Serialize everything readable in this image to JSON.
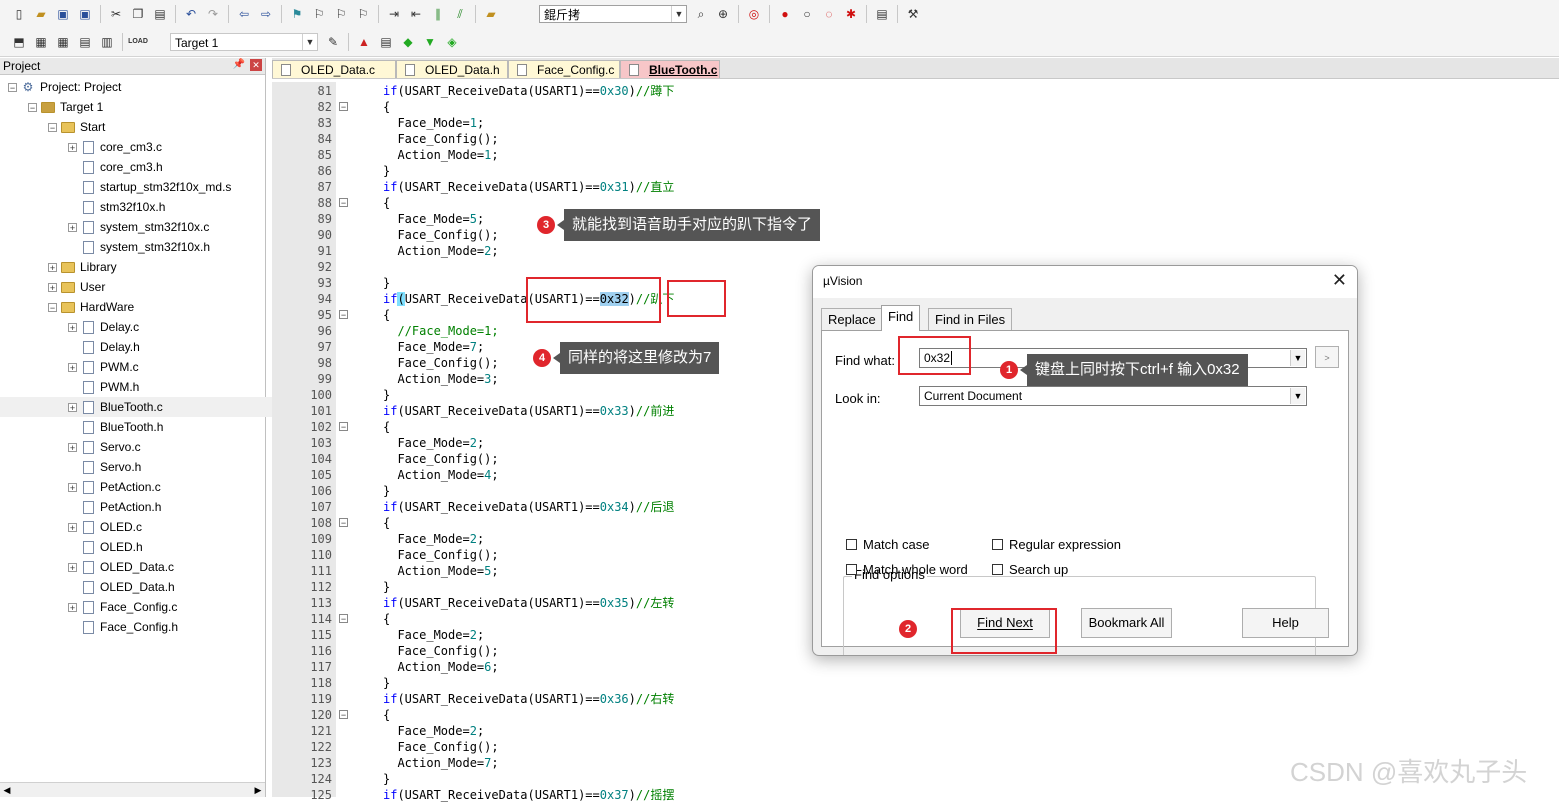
{
  "toolbar1": {
    "icons": [
      "new-file-icon",
      "open-folder-icon",
      "save-icon",
      "save-all-icon",
      "cut-icon",
      "copy-icon",
      "paste-icon",
      "undo-icon",
      "redo-icon",
      "nav-back-icon",
      "nav-forward-icon",
      "bookmark-icon",
      "bookmark-prev-icon",
      "bookmark-next-icon",
      "bookmark-clear-icon",
      "indent-icon",
      "unindent-icon",
      "comment-icon",
      "uncomment-icon",
      "find-folder-icon"
    ],
    "search_combo_value": "錕斤拷",
    "right_icons": [
      "find-icon",
      "debug-icon",
      "zoom-icon",
      "breakpoint-icon",
      "breakpoint-disable-icon",
      "breakpoint-kill-icon",
      "breakpoint-all-icon",
      "window-icon",
      "settings-icon"
    ]
  },
  "toolbar2": {
    "target_label": "Target 1"
  },
  "project": {
    "title": "Project",
    "items": [
      {
        "label": "Project: Project",
        "level": 0,
        "expander": "-",
        "icon": "root"
      },
      {
        "label": "Target 1",
        "level": 1,
        "expander": "-",
        "icon": "target"
      },
      {
        "label": "Start",
        "level": 2,
        "expander": "-",
        "icon": "folder"
      },
      {
        "label": "core_cm3.c",
        "level": 3,
        "expander": "+",
        "icon": "file"
      },
      {
        "label": "core_cm3.h",
        "level": 3,
        "expander": "",
        "icon": "file"
      },
      {
        "label": "startup_stm32f10x_md.s",
        "level": 3,
        "expander": "",
        "icon": "file"
      },
      {
        "label": "stm32f10x.h",
        "level": 3,
        "expander": "",
        "icon": "file"
      },
      {
        "label": "system_stm32f10x.c",
        "level": 3,
        "expander": "+",
        "icon": "file"
      },
      {
        "label": "system_stm32f10x.h",
        "level": 3,
        "expander": "",
        "icon": "file"
      },
      {
        "label": "Library",
        "level": 2,
        "expander": "+",
        "icon": "folder"
      },
      {
        "label": "User",
        "level": 2,
        "expander": "+",
        "icon": "folder"
      },
      {
        "label": "HardWare",
        "level": 2,
        "expander": "-",
        "icon": "folder"
      },
      {
        "label": "Delay.c",
        "level": 3,
        "expander": "+",
        "icon": "file"
      },
      {
        "label": "Delay.h",
        "level": 3,
        "expander": "",
        "icon": "file"
      },
      {
        "label": "PWM.c",
        "level": 3,
        "expander": "+",
        "icon": "file"
      },
      {
        "label": "PWM.h",
        "level": 3,
        "expander": "",
        "icon": "file"
      },
      {
        "label": "BlueTooth.c",
        "level": 3,
        "expander": "+",
        "icon": "file",
        "selected": true
      },
      {
        "label": "BlueTooth.h",
        "level": 3,
        "expander": "",
        "icon": "file"
      },
      {
        "label": "Servo.c",
        "level": 3,
        "expander": "+",
        "icon": "file"
      },
      {
        "label": "Servo.h",
        "level": 3,
        "expander": "",
        "icon": "file"
      },
      {
        "label": "PetAction.c",
        "level": 3,
        "expander": "+",
        "icon": "file"
      },
      {
        "label": "PetAction.h",
        "level": 3,
        "expander": "",
        "icon": "file"
      },
      {
        "label": "OLED.c",
        "level": 3,
        "expander": "+",
        "icon": "file"
      },
      {
        "label": "OLED.h",
        "level": 3,
        "expander": "",
        "icon": "file"
      },
      {
        "label": "OLED_Data.c",
        "level": 3,
        "expander": "+",
        "icon": "file"
      },
      {
        "label": "OLED_Data.h",
        "level": 3,
        "expander": "",
        "icon": "file"
      },
      {
        "label": "Face_Config.c",
        "level": 3,
        "expander": "+",
        "icon": "file"
      },
      {
        "label": "Face_Config.h",
        "level": 3,
        "expander": "",
        "icon": "file"
      }
    ]
  },
  "tabs": [
    {
      "label": "OLED_Data.c",
      "active": false
    },
    {
      "label": "OLED_Data.h",
      "active": false
    },
    {
      "label": "Face_Config.c",
      "active": false
    },
    {
      "label": "BlueTooth.c",
      "active": true
    }
  ],
  "code": [
    {
      "n": "81",
      "t": "if(USART_ReceiveData(USART1)==0x30)//蹲下",
      "fold": false
    },
    {
      "n": "82",
      "t": "{",
      "fold": true
    },
    {
      "n": "83",
      "t": "  Face_Mode=1;",
      "fold": false
    },
    {
      "n": "84",
      "t": "  Face_Config();",
      "fold": false
    },
    {
      "n": "85",
      "t": "  Action_Mode=1;",
      "fold": false
    },
    {
      "n": "86",
      "t": "}",
      "fold": false
    },
    {
      "n": "87",
      "t": "if(USART_ReceiveData(USART1)==0x31)//直立",
      "fold": false
    },
    {
      "n": "88",
      "t": "{",
      "fold": true
    },
    {
      "n": "89",
      "t": "  Face_Mode=5;",
      "fold": false
    },
    {
      "n": "90",
      "t": "  Face_Config();",
      "fold": false
    },
    {
      "n": "91",
      "t": "  Action_Mode=2;",
      "fold": false
    },
    {
      "n": "92",
      "t": "",
      "fold": false
    },
    {
      "n": "93",
      "t": "}",
      "fold": false
    },
    {
      "n": "94",
      "t": "if(USART_ReceiveData(USART1)==0x32)//趴下",
      "fold": false,
      "highlight": true
    },
    {
      "n": "95",
      "t": "{",
      "fold": true
    },
    {
      "n": "96",
      "t": "  //Face_Mode=1;",
      "fold": false
    },
    {
      "n": "97",
      "t": "  Face_Mode=7;",
      "fold": false
    },
    {
      "n": "98",
      "t": "  Face_Config();",
      "fold": false
    },
    {
      "n": "99",
      "t": "  Action_Mode=3;",
      "fold": false
    },
    {
      "n": "100",
      "t": "}",
      "fold": false
    },
    {
      "n": "101",
      "t": "if(USART_ReceiveData(USART1)==0x33)//前进",
      "fold": false
    },
    {
      "n": "102",
      "t": "{",
      "fold": true
    },
    {
      "n": "103",
      "t": "  Face_Mode=2;",
      "fold": false
    },
    {
      "n": "104",
      "t": "  Face_Config();",
      "fold": false
    },
    {
      "n": "105",
      "t": "  Action_Mode=4;",
      "fold": false
    },
    {
      "n": "106",
      "t": "}",
      "fold": false
    },
    {
      "n": "107",
      "t": "if(USART_ReceiveData(USART1)==0x34)//后退",
      "fold": false
    },
    {
      "n": "108",
      "t": "{",
      "fold": true
    },
    {
      "n": "109",
      "t": "  Face_Mode=2;",
      "fold": false
    },
    {
      "n": "110",
      "t": "  Face_Config();",
      "fold": false
    },
    {
      "n": "111",
      "t": "  Action_Mode=5;",
      "fold": false
    },
    {
      "n": "112",
      "t": "}",
      "fold": false
    },
    {
      "n": "113",
      "t": "if(USART_ReceiveData(USART1)==0x35)//左转",
      "fold": false
    },
    {
      "n": "114",
      "t": "{",
      "fold": true
    },
    {
      "n": "115",
      "t": "  Face_Mode=2;",
      "fold": false
    },
    {
      "n": "116",
      "t": "  Face_Config();",
      "fold": false
    },
    {
      "n": "117",
      "t": "  Action_Mode=6;",
      "fold": false
    },
    {
      "n": "118",
      "t": "}",
      "fold": false
    },
    {
      "n": "119",
      "t": "if(USART_ReceiveData(USART1)==0x36)//右转",
      "fold": false
    },
    {
      "n": "120",
      "t": "{",
      "fold": true
    },
    {
      "n": "121",
      "t": "  Face_Mode=2;",
      "fold": false
    },
    {
      "n": "122",
      "t": "  Face_Config();",
      "fold": false
    },
    {
      "n": "123",
      "t": "  Action_Mode=7;",
      "fold": false
    },
    {
      "n": "124",
      "t": "}",
      "fold": false
    },
    {
      "n": "125",
      "t": "if(USART_ReceiveData(USART1)==0x37)//摇摆",
      "fold": false
    }
  ],
  "annotations": {
    "a1": {
      "num": "1",
      "text": "键盘上同时按下ctrl+f 输入0x32"
    },
    "a2": {
      "num": "2"
    },
    "a3": {
      "num": "3",
      "text": "就能找到语音助手对应的趴下指令了"
    },
    "a4": {
      "num": "4",
      "text": "同样的将这里修改为7"
    }
  },
  "dialog": {
    "title": "µVision",
    "tabs": [
      "Replace",
      "Find",
      "Find in Files"
    ],
    "active_tab": "Find",
    "find_what_label": "Find what:",
    "find_what_value": "0x32",
    "look_in_label": "Look in:",
    "look_in_value": "Current Document",
    "more_button": ">",
    "find_options_title": "Find options",
    "options": {
      "match_case": "Match case",
      "regular_expression": "Regular expression",
      "match_whole_word": "Match whole word",
      "search_up": "Search up"
    },
    "buttons": {
      "find_next": "Find Next",
      "bookmark_all": "Bookmark All",
      "help": "Help"
    }
  },
  "watermark": "CSDN @喜欢丸子头"
}
